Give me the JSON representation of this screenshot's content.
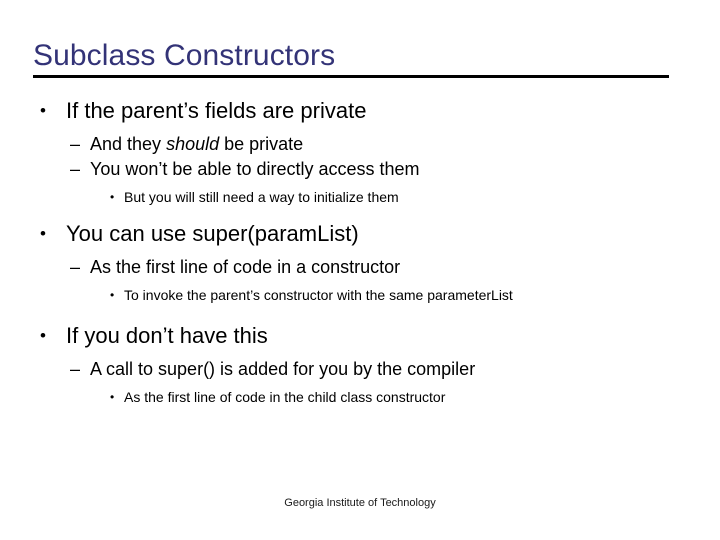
{
  "slide": {
    "title": "Subclass Constructors",
    "title_color": "#333377",
    "rule_color": "#000000",
    "background_color": "#ffffff",
    "body_text_color": "#000000"
  },
  "marks": {
    "level1": "•",
    "level2": "–",
    "level3": "•"
  },
  "content": [
    {
      "level": 1,
      "text": "If the parent’s fields are private"
    },
    {
      "level": 2,
      "text_before_italic": "And they ",
      "italic": "should",
      "text_after_italic": " be private"
    },
    {
      "level": 2,
      "text": "You won’t be able to directly access them"
    },
    {
      "level": 3,
      "text": "But you will still need a way to initialize them"
    },
    {
      "level": 1,
      "text": "You can use super(paramList)"
    },
    {
      "level": 2,
      "text": "As the first line of code in a constructor"
    },
    {
      "level": 3,
      "text": "To invoke the parent’s constructor with the same parameterList"
    },
    {
      "level": 1,
      "text": "If you don’t have this"
    },
    {
      "level": 2,
      "text": "A call to super() is added for you by the compiler"
    },
    {
      "level": 3,
      "text": "As the first line of code in the child class constructor"
    }
  ],
  "footer": {
    "text": "Georgia Institute of Technology"
  }
}
